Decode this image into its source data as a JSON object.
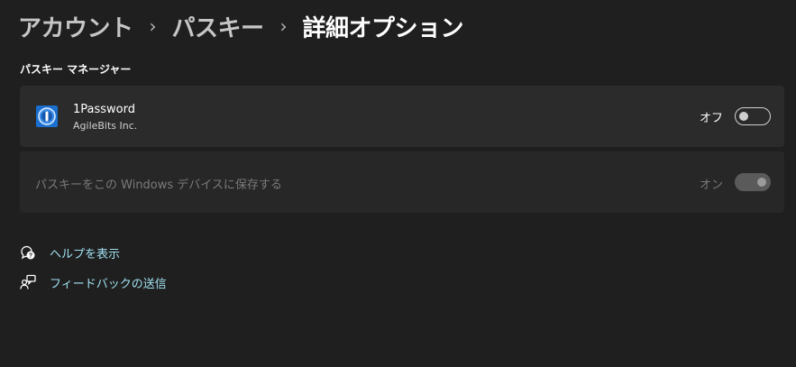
{
  "breadcrumb": {
    "items": [
      "アカウント",
      "パスキー",
      "詳細オプション"
    ],
    "separator": "›"
  },
  "section": {
    "title": "パスキー マネージャー"
  },
  "providers": [
    {
      "name": "1Password",
      "vendor": "AgileBits Inc.",
      "toggle_label": "オフ",
      "toggle_on": false,
      "icon": "1password-icon"
    }
  ],
  "windows_save": {
    "label": "パスキーをこの Windows デバイスに保存する",
    "toggle_label": "オン",
    "toggle_on": true,
    "disabled": true
  },
  "links": {
    "help": "ヘルプを表示",
    "feedback": "フィードバックの送信"
  },
  "colors": {
    "background": "#1f1f1f",
    "card": "#2b2b2b",
    "link": "#9fe0f0",
    "icon_blue": "#1a6fd0"
  }
}
